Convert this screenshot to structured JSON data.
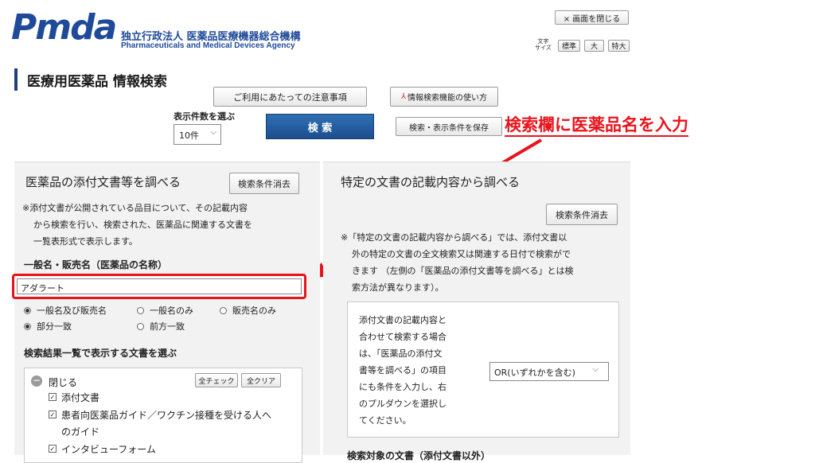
{
  "header": {
    "logo_text": "Pmda",
    "org_name_jp": "独立行政法人 医薬品医療機器総合機構",
    "org_name_en": "Pharmaceuticals and Medical Devices Agency",
    "close_window_label": "× 画面を閉じる",
    "font_size_label": "文字\nサイズ",
    "font_size_options": [
      "標準",
      "大",
      "特大"
    ]
  },
  "page": {
    "title": "医療用医薬品 情報検索",
    "notice_button": "ご利用にあたっての注意事項",
    "howto_button": "情報検索機能の使い方",
    "display_count_label": "表示件数を選ぶ",
    "display_count_value": "10件",
    "search_button": "検 索",
    "save_conditions_button": "検索・表示条件を保存"
  },
  "annotation": {
    "text": "検索欄に医薬品名を入力",
    "color": "#e8141c"
  },
  "left_panel": {
    "title": "医薬品の添付文書等を調べる",
    "clear_button": "検索条件消去",
    "description_lines": [
      "※添付文書が公開されている品目について、その記載内容",
      "から検索を行い、検索された、医薬品に関連する文書を",
      "一覧表形式で表示します。"
    ],
    "name_label": "一般名・販売名（医薬品の名称）",
    "name_input_value": "アダラート",
    "name_scope_options": [
      {
        "label": "一般名及び販売名",
        "selected": true
      },
      {
        "label": "一般名のみ",
        "selected": false
      },
      {
        "label": "販売名のみ",
        "selected": false
      }
    ],
    "match_options": [
      {
        "label": "部分一致",
        "selected": true
      },
      {
        "label": "前方一致",
        "selected": false
      }
    ],
    "doc_select_label": "検索結果一覧で表示する文書を選ぶ",
    "collapse_label": "閉じる",
    "check_all_button": "全チェック",
    "clear_all_button": "全クリア",
    "documents": [
      {
        "label": "添付文書",
        "checked": true
      },
      {
        "label": "患者向医薬品ガイド／ワクチン接種を受ける人へ",
        "checked": true
      },
      {
        "label": "のガイド",
        "checked": null
      },
      {
        "label": "インタビューフォーム",
        "checked": true
      }
    ]
  },
  "right_panel": {
    "title": "特定の文書の記載内容から調べる",
    "clear_button": "検索条件消去",
    "description_lines": [
      "※「特定の文書の記載内容から調べる」では、添付文書以",
      "外の特定の文書の全文検索又は関連する日付で検索がで",
      "きます （左側の「医薬品の添付文書等を調べる」とは検",
      "索方法が異なります）。"
    ],
    "combine_text_lines": [
      "添付文書の記載内容と",
      "合わせて検索する場合",
      "は、「医薬品の添付文",
      "書等を調べる」の項目",
      "にも条件を入力し、右",
      "のプルダウンを選択し",
      "てください。"
    ],
    "combine_select_value": "OR(いずれかを含む)",
    "bottom_label": "検索対象の文書（添付文書以外）"
  }
}
